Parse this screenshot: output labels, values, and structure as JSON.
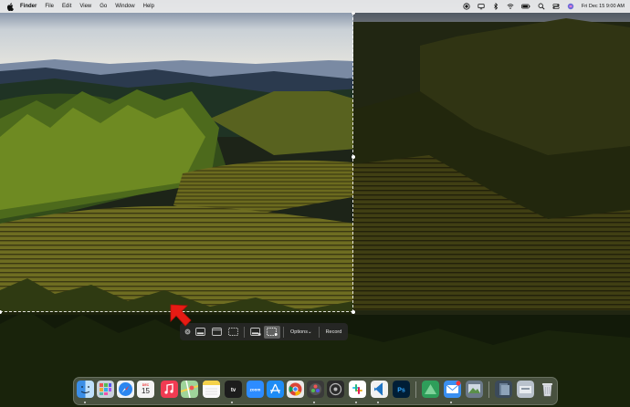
{
  "menubar": {
    "app_name": "Finder",
    "items": [
      "File",
      "Edit",
      "View",
      "Go",
      "Window",
      "Help"
    ],
    "clock": "Fri Dec 15  9:00 AM",
    "status_icons": [
      "screen-record-icon",
      "display-icon",
      "bluetooth-icon",
      "wifi-icon",
      "battery-icon",
      "search-icon",
      "control-center-icon",
      "siri-icon"
    ]
  },
  "capture_toolbar": {
    "buttons": [
      {
        "name": "close",
        "icon": "close-icon"
      },
      {
        "name": "capture-entire-screen",
        "icon": "capture-entire-screen-icon"
      },
      {
        "name": "capture-selected-window",
        "icon": "capture-window-icon"
      },
      {
        "name": "capture-selected-portion",
        "icon": "capture-selection-icon"
      },
      {
        "name": "record-entire-screen",
        "icon": "record-screen-icon"
      },
      {
        "name": "record-selected-portion",
        "icon": "record-selection-icon",
        "active": true
      }
    ],
    "options_label": "Options",
    "options_chevron": "⌄",
    "record_label": "Record"
  },
  "dock": {
    "calendar": {
      "month": "DEC",
      "day": "15"
    },
    "apps": [
      {
        "name": "finder",
        "color": "#3a8ee6"
      },
      {
        "name": "launchpad",
        "color": "#c9d2dc"
      },
      {
        "name": "safari",
        "color": "#2a86f0"
      },
      {
        "name": "calendar",
        "color": "#f4f4f4"
      },
      {
        "name": "music",
        "color": "#f03b52"
      },
      {
        "name": "maps",
        "color": "#69b86a"
      },
      {
        "name": "notes",
        "color": "#f5d24a"
      },
      {
        "name": "apple-tv",
        "color": "#1c1c1c",
        "label": "tv"
      },
      {
        "name": "zoom",
        "color": "#2d8cff",
        "label": "zoom"
      },
      {
        "name": "app-store",
        "color": "#1e8cf5"
      },
      {
        "name": "chrome",
        "color": "#e9e9e9"
      },
      {
        "name": "davinci-resolve",
        "color": "#3a3a3a"
      },
      {
        "name": "slack",
        "color": "#ffffff"
      },
      {
        "name": "vscode",
        "color": "#1f74c4"
      },
      {
        "name": "photoshop",
        "color": "#001e36",
        "label": "Ps"
      },
      {
        "name": "green-app",
        "color": "#2e9e5a"
      },
      {
        "name": "mail",
        "color": "#3a8ff0"
      },
      {
        "name": "preview",
        "color": "#6c7a8a"
      },
      {
        "name": "file-stack",
        "color": "#3b4a5a"
      },
      {
        "name": "downloads",
        "color": "#b9c2cc"
      },
      {
        "name": "trash",
        "color": "#d9dde2"
      }
    ]
  }
}
